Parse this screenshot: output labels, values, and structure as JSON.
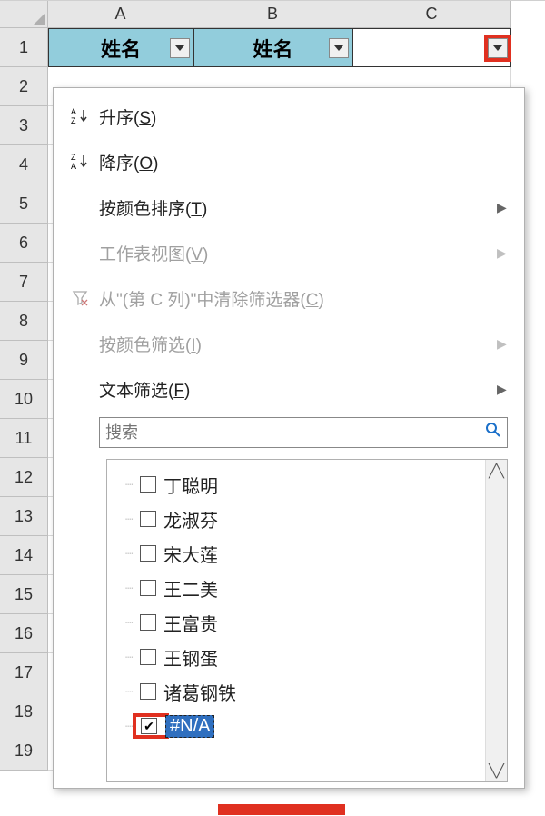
{
  "columns": {
    "A": "A",
    "B": "B",
    "C": "C"
  },
  "rows": [
    "1",
    "2",
    "3",
    "4",
    "5",
    "6",
    "7",
    "8",
    "9",
    "10",
    "11",
    "12",
    "13",
    "14",
    "15",
    "16",
    "17",
    "18",
    "19"
  ],
  "headerRow": {
    "A": "姓名",
    "B": "姓名",
    "C": ""
  },
  "menu": {
    "sortAsc": "升序(S)",
    "sortDesc": "降序(O)",
    "sortByColor": "按颜色排序(T)",
    "sheetView": "工作表视图(V)",
    "clearFilter": "从\"(第 C 列)\"中清除筛选器(C)",
    "filterByColor": "按颜色筛选(I)",
    "textFilter": "文本筛选(F)"
  },
  "search": {
    "placeholder": "搜索"
  },
  "items": [
    {
      "label": "丁聪明",
      "checked": false
    },
    {
      "label": "龙淑芬",
      "checked": false
    },
    {
      "label": "宋大莲",
      "checked": false
    },
    {
      "label": "王二美",
      "checked": false
    },
    {
      "label": "王富贵",
      "checked": false
    },
    {
      "label": "王钢蛋",
      "checked": false
    },
    {
      "label": "诸葛钢铁",
      "checked": false
    },
    {
      "label": "#N/A",
      "checked": true,
      "na": true
    }
  ],
  "icons": {
    "asc": "A→Z",
    "desc": "Z→A"
  }
}
